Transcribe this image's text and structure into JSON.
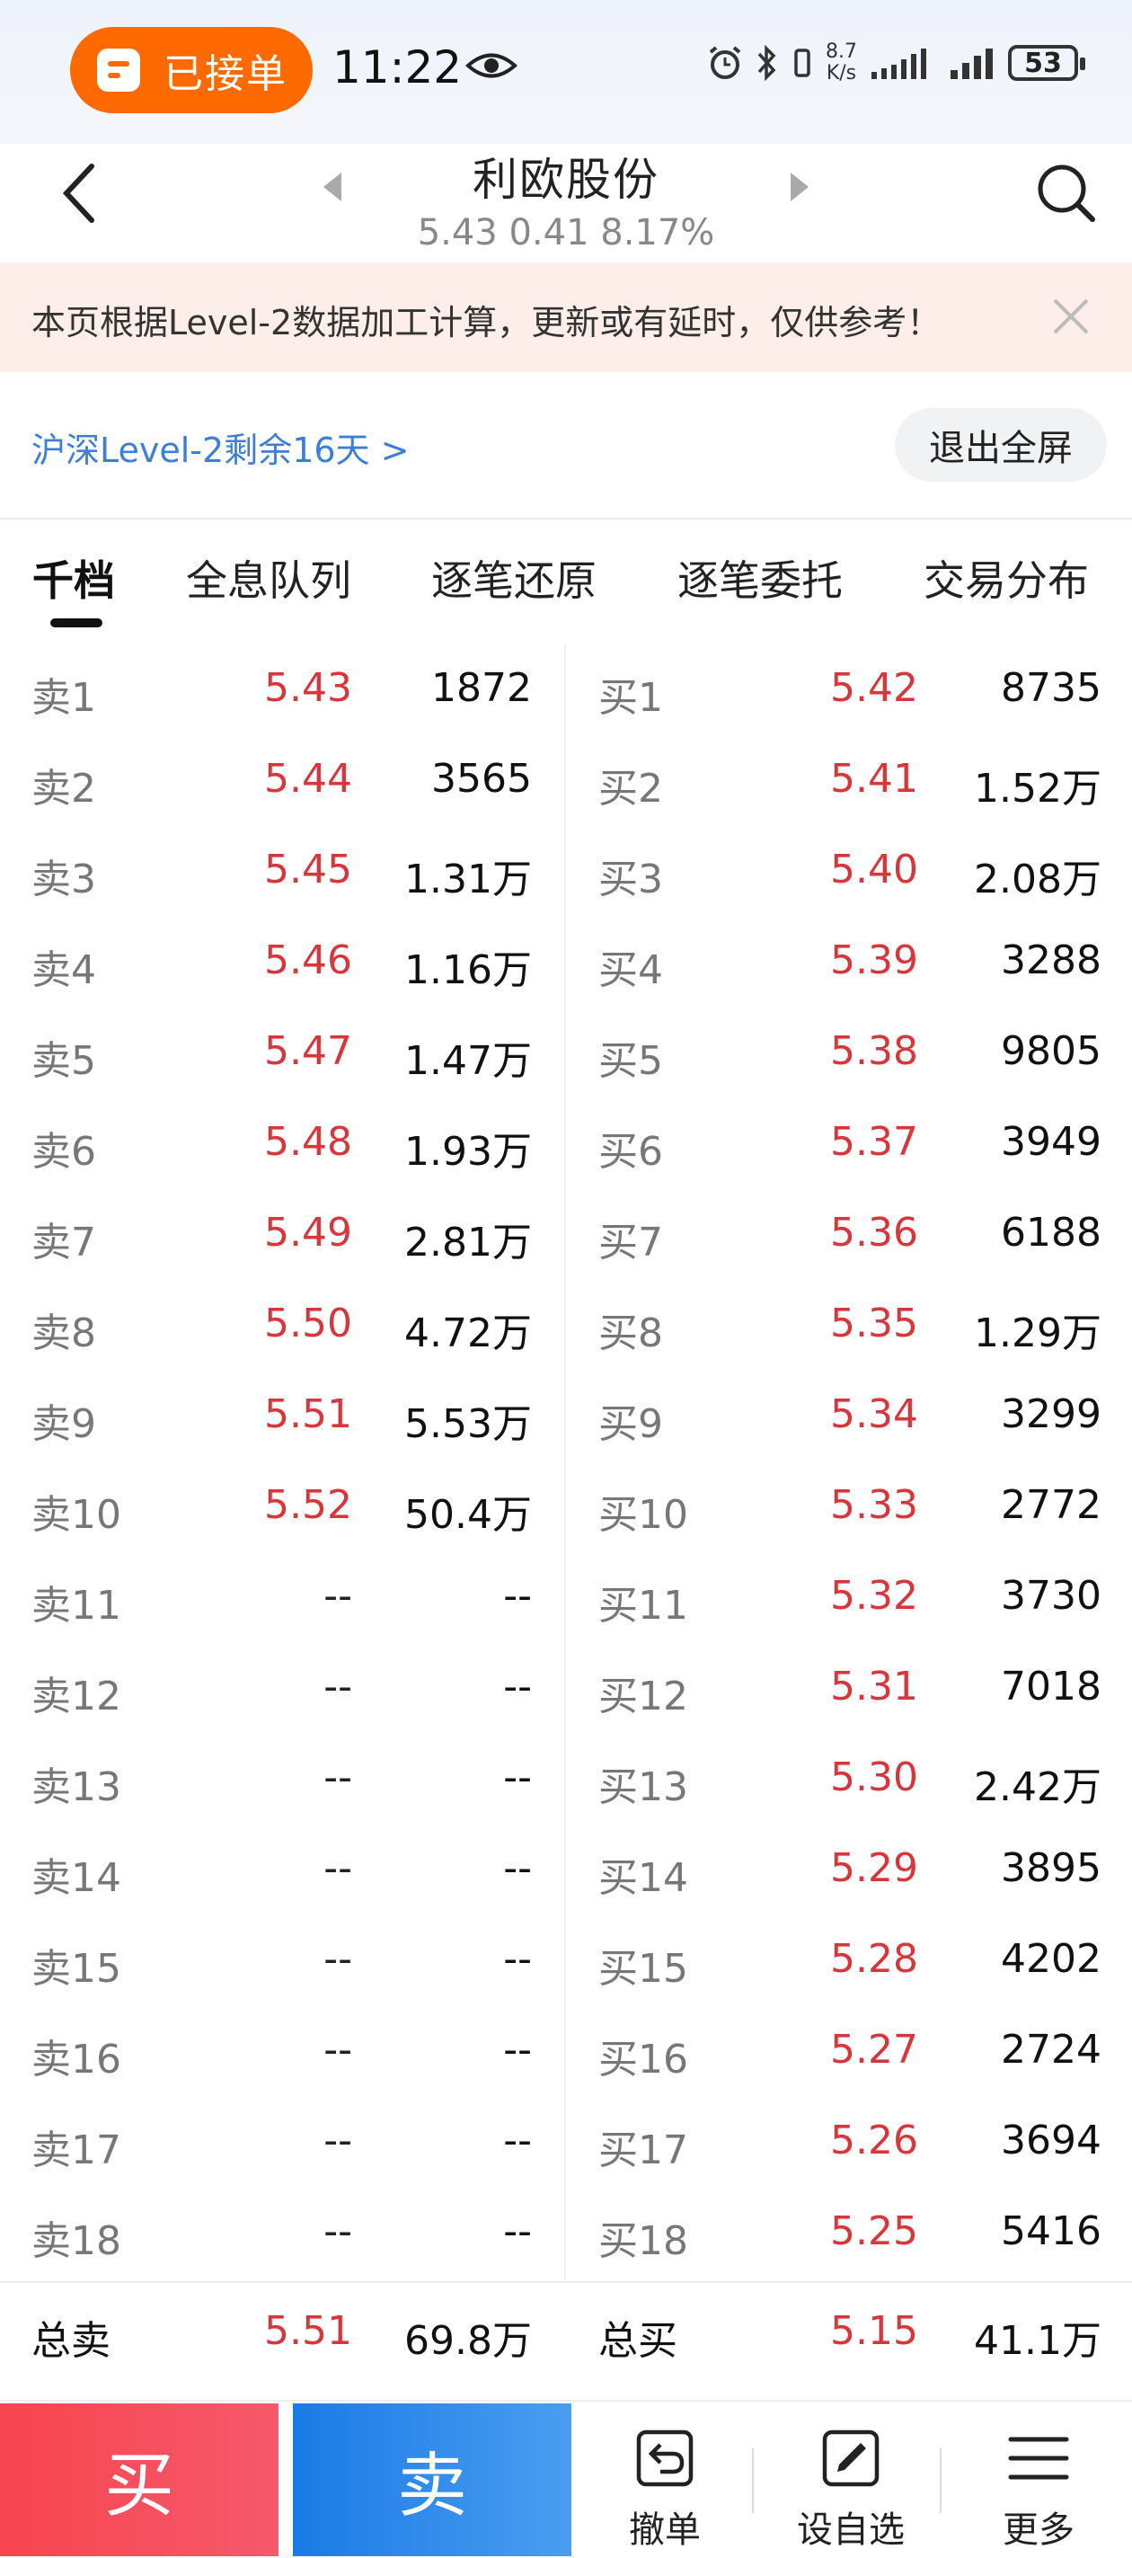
{
  "status_bar": {
    "order_pill": "已接单",
    "time": "11:22",
    "net_speed_value": "8.7",
    "net_speed_unit": "K/s",
    "battery": "53"
  },
  "header": {
    "stock_name": "利欧股份",
    "quote": "5.43 0.41 8.17%"
  },
  "notice": {
    "text": "本页根据Level-2数据加工计算，更新或有延时，仅供参考！"
  },
  "level2": {
    "link": "沪深Level-2剩余16天 >",
    "fullscreen_button": "退出全屏"
  },
  "tabs": [
    "千档",
    "全息队列",
    "逐笔还原",
    "逐笔委托",
    "交易分布"
  ],
  "active_tab": "千档",
  "colors": {
    "price_red": "#d8363a",
    "buy_red": "#f7454f",
    "sell_blue": "#1a7ae6"
  },
  "order_book": {
    "sell": [
      {
        "label": "卖1",
        "price": "5.43",
        "volume": "1872"
      },
      {
        "label": "卖2",
        "price": "5.44",
        "volume": "3565"
      },
      {
        "label": "卖3",
        "price": "5.45",
        "volume": "1.31万"
      },
      {
        "label": "卖4",
        "price": "5.46",
        "volume": "1.16万"
      },
      {
        "label": "卖5",
        "price": "5.47",
        "volume": "1.47万"
      },
      {
        "label": "卖6",
        "price": "5.48",
        "volume": "1.93万"
      },
      {
        "label": "卖7",
        "price": "5.49",
        "volume": "2.81万"
      },
      {
        "label": "卖8",
        "price": "5.50",
        "volume": "4.72万"
      },
      {
        "label": "卖9",
        "price": "5.51",
        "volume": "5.53万"
      },
      {
        "label": "卖10",
        "price": "5.52",
        "volume": "50.4万"
      },
      {
        "label": "卖11",
        "price": "--",
        "volume": "--"
      },
      {
        "label": "卖12",
        "price": "--",
        "volume": "--"
      },
      {
        "label": "卖13",
        "price": "--",
        "volume": "--"
      },
      {
        "label": "卖14",
        "price": "--",
        "volume": "--"
      },
      {
        "label": "卖15",
        "price": "--",
        "volume": "--"
      },
      {
        "label": "卖16",
        "price": "--",
        "volume": "--"
      },
      {
        "label": "卖17",
        "price": "--",
        "volume": "--"
      },
      {
        "label": "卖18",
        "price": "--",
        "volume": "--"
      }
    ],
    "buy": [
      {
        "label": "买1",
        "price": "5.42",
        "volume": "8735"
      },
      {
        "label": "买2",
        "price": "5.41",
        "volume": "1.52万"
      },
      {
        "label": "买3",
        "price": "5.40",
        "volume": "2.08万"
      },
      {
        "label": "买4",
        "price": "5.39",
        "volume": "3288"
      },
      {
        "label": "买5",
        "price": "5.38",
        "volume": "9805"
      },
      {
        "label": "买6",
        "price": "5.37",
        "volume": "3949"
      },
      {
        "label": "买7",
        "price": "5.36",
        "volume": "6188"
      },
      {
        "label": "买8",
        "price": "5.35",
        "volume": "1.29万"
      },
      {
        "label": "买9",
        "price": "5.34",
        "volume": "3299"
      },
      {
        "label": "买10",
        "price": "5.33",
        "volume": "2772"
      },
      {
        "label": "买11",
        "price": "5.32",
        "volume": "3730"
      },
      {
        "label": "买12",
        "price": "5.31",
        "volume": "7018"
      },
      {
        "label": "买13",
        "price": "5.30",
        "volume": "2.42万"
      },
      {
        "label": "买14",
        "price": "5.29",
        "volume": "3895"
      },
      {
        "label": "买15",
        "price": "5.28",
        "volume": "4202"
      },
      {
        "label": "买16",
        "price": "5.27",
        "volume": "2724"
      },
      {
        "label": "买17",
        "price": "5.26",
        "volume": "3694"
      },
      {
        "label": "买18",
        "price": "5.25",
        "volume": "5416"
      }
    ],
    "total_sell": {
      "label": "总卖",
      "price": "5.51",
      "volume": "69.8万"
    },
    "total_buy": {
      "label": "总买",
      "price": "5.15",
      "volume": "41.1万"
    }
  },
  "bottom_bar": {
    "buy": "买",
    "sell": "卖",
    "cancel": "撤单",
    "watchlist": "设自选",
    "more": "更多"
  }
}
